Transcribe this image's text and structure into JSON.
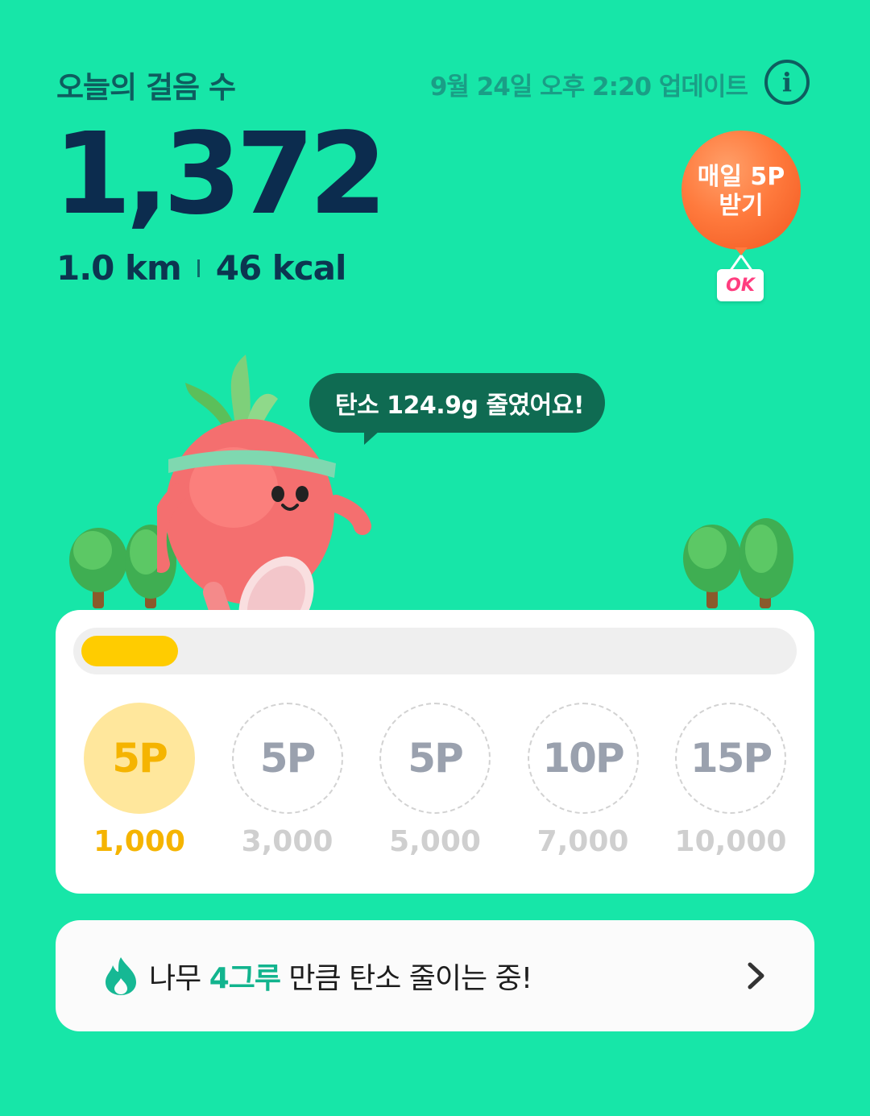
{
  "header": {
    "title": "오늘의 걸음 수",
    "updated": "9월 24일 오후 2:20 업데이트",
    "info_icon_glyph": "i"
  },
  "steps": {
    "count": "1,372",
    "distance": "1.0 km",
    "calories": "46 kcal"
  },
  "promo": {
    "line1": "매일 5P",
    "line2": "받기",
    "badge": "OK"
  },
  "bubble": {
    "text": "탄소 124.9g 줄였어요!"
  },
  "progress": {
    "fraction": 0.137,
    "fill_color": "#ffcc00"
  },
  "milestones": [
    {
      "reward": "5P",
      "steps": "1,000",
      "achieved": true
    },
    {
      "reward": "5P",
      "steps": "3,000",
      "achieved": false
    },
    {
      "reward": "5P",
      "steps": "5,000",
      "achieved": false
    },
    {
      "reward": "10P",
      "steps": "7,000",
      "achieved": false
    },
    {
      "reward": "15P",
      "steps": "10,000",
      "achieved": false
    }
  ],
  "carbon": {
    "prefix": "나무 ",
    "highlight": "4그루",
    "suffix": " 만큼 탄소 줄이는 중!",
    "icon": "flame-icon"
  },
  "colors": {
    "background": "#17e6a8",
    "accent_dark": "#0c2c4e",
    "achieved": "#f5b400",
    "highlight": "#12b48e"
  }
}
